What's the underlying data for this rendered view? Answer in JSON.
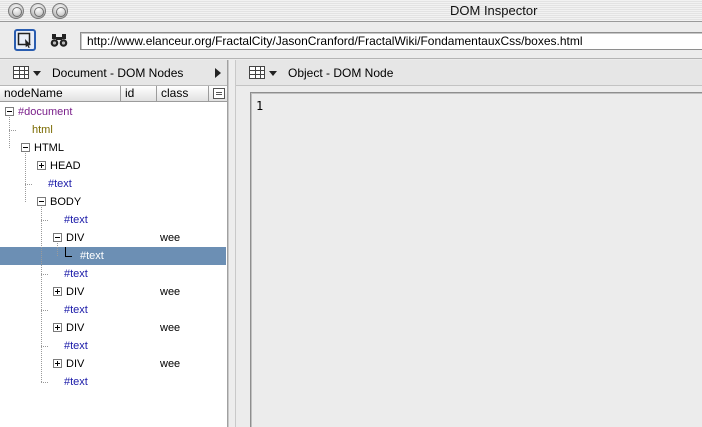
{
  "window": {
    "title": "DOM Inspector"
  },
  "toolbar": {
    "url": "http://www.elanceur.org/FractalCity/JasonCranford/FractalWiki/FondamentauxCss/boxes.html",
    "inspect_icon": "inspect-icon",
    "find_icon": "binoculars-icon"
  },
  "left_panel": {
    "title": "Document - DOM Nodes",
    "columns": [
      "nodeName",
      "id",
      "class"
    ]
  },
  "tree": [
    {
      "name": "#document",
      "kind": "doc",
      "depth": 0,
      "twisty": "minus",
      "class": ""
    },
    {
      "name": "html",
      "kind": "dt",
      "depth": 1,
      "twisty": "",
      "class": ""
    },
    {
      "name": "HTML",
      "kind": "el",
      "depth": 1,
      "twisty": "minus",
      "class": ""
    },
    {
      "name": "HEAD",
      "kind": "el",
      "depth": 2,
      "twisty": "plus",
      "class": ""
    },
    {
      "name": "#text",
      "kind": "text",
      "depth": 2,
      "twisty": "",
      "class": ""
    },
    {
      "name": "BODY",
      "kind": "el",
      "depth": 2,
      "twisty": "minus",
      "class": ""
    },
    {
      "name": "#text",
      "kind": "text",
      "depth": 3,
      "twisty": "",
      "class": ""
    },
    {
      "name": "DIV",
      "kind": "el",
      "depth": 3,
      "twisty": "minus",
      "class": "wee"
    },
    {
      "name": "#text",
      "kind": "text",
      "depth": 4,
      "twisty": "",
      "class": "",
      "selected": true
    },
    {
      "name": "#text",
      "kind": "text",
      "depth": 3,
      "twisty": "",
      "class": ""
    },
    {
      "name": "DIV",
      "kind": "el",
      "depth": 3,
      "twisty": "plus",
      "class": "wee"
    },
    {
      "name": "#text",
      "kind": "text",
      "depth": 3,
      "twisty": "",
      "class": ""
    },
    {
      "name": "DIV",
      "kind": "el",
      "depth": 3,
      "twisty": "plus",
      "class": "wee"
    },
    {
      "name": "#text",
      "kind": "text",
      "depth": 3,
      "twisty": "",
      "class": ""
    },
    {
      "name": "DIV",
      "kind": "el",
      "depth": 3,
      "twisty": "plus",
      "class": "wee"
    },
    {
      "name": "#text",
      "kind": "text",
      "depth": 3,
      "twisty": "",
      "class": ""
    }
  ],
  "right_panel": {
    "title": "Object - DOM Node",
    "node_value": "1"
  },
  "colors": {
    "selection": "#6c8fb4",
    "document_node": "#7a1f8a",
    "doctype_node": "#7a6a00",
    "text_node": "#1a1aa8"
  }
}
